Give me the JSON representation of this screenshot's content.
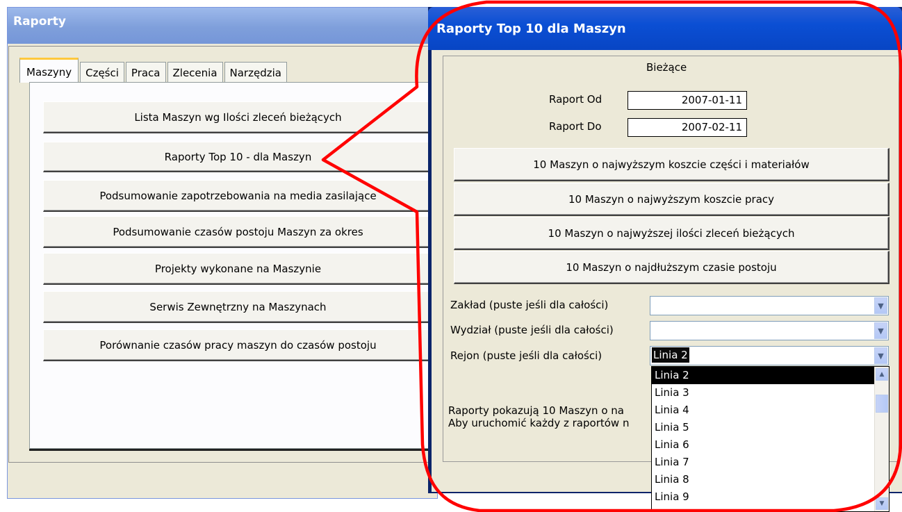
{
  "left_window": {
    "title": "Raporty",
    "tabs": [
      "Maszyny",
      "Części",
      "Praca",
      "Zlecenia",
      "Narzędzia"
    ],
    "active_tab": "Maszyny",
    "buttons": [
      "Lista Maszyn wg Ilości zleceń bieżących",
      "Raporty Top 10 - dla Maszyn",
      "Podsumowanie zapotrzebowania na media zasilające",
      "Podsumowanie czasów postoju Maszyn za okres",
      "Projekty wykonane na Maszynie",
      "Serwis Zewnętrzny na Maszynach",
      "Porównanie czasów pracy maszyn do czasów postoju"
    ]
  },
  "right_window": {
    "title": "Raporty Top 10 dla Maszyn",
    "group_title": "Bieżące",
    "raport_od_label": "Raport Od",
    "raport_od_value": "2007-01-11",
    "raport_do_label": "Raport Do",
    "raport_do_value": "2007-02-11",
    "buttons": [
      "10 Maszyn o najwyższym koszcie części i materiałów",
      "10 Maszyn o najwyższym koszcie pracy",
      "10 Maszyn o najwyższej ilości zleceń bieżących",
      "10 Maszyn o najdłuższym czasie postoju"
    ],
    "zaklad_label": "Zakład (puste jeśli dla całości)",
    "zaklad_value": "",
    "wydzial_label": "Wydział (puste jeśli dla całości)",
    "wydzial_value": "",
    "rejon_label": "Rejon (puste jeśli dla całości)",
    "rejon_value": "Linia 2",
    "info_line1": "Raporty pokazują 10 Maszyn o na",
    "info_line2": "Aby uruchomić każdy z raportów n",
    "dropdown_options": [
      "Linia 2",
      "Linia 3",
      "Linia 4",
      "Linia 5",
      "Linia 6",
      "Linia 7",
      "Linia 8",
      "Linia 9"
    ],
    "dropdown_highlighted": "Linia 2"
  },
  "annotation": {
    "color": "#ff0000"
  }
}
